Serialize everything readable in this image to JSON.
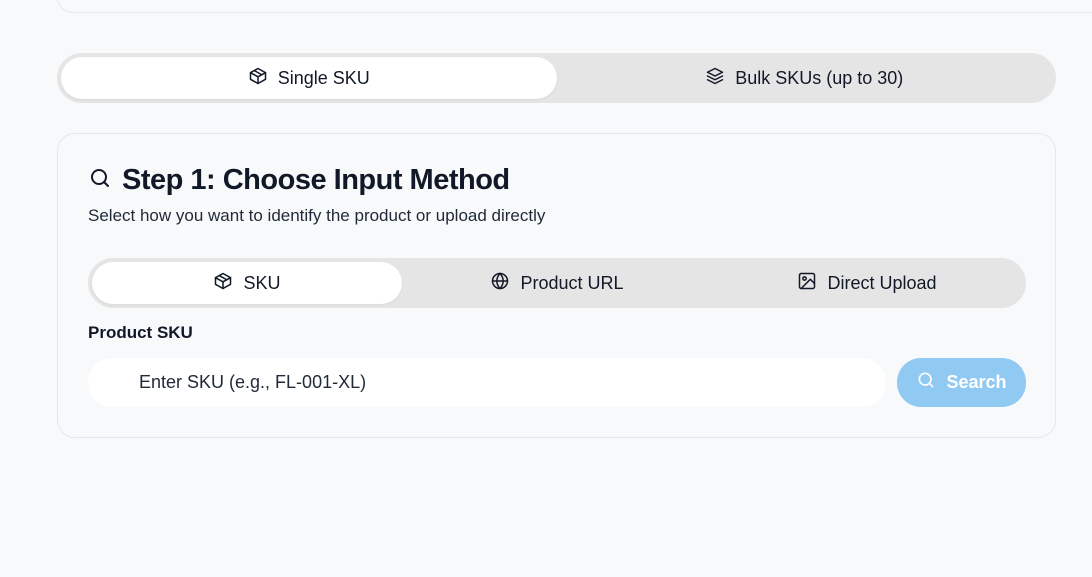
{
  "mode_toggle": {
    "tabs": [
      {
        "label": "Single SKU",
        "icon": "box-icon",
        "active": true
      },
      {
        "label": "Bulk SKUs (up to 30)",
        "icon": "layers-icon",
        "active": false
      }
    ]
  },
  "step": {
    "title": "Step 1: Choose Input Method",
    "subtitle": "Select how you want to identify the product or upload directly",
    "icon": "search-icon"
  },
  "method_toggle": {
    "tabs": [
      {
        "label": "SKU",
        "icon": "box-icon",
        "active": true
      },
      {
        "label": "Product URL",
        "icon": "globe-icon",
        "active": false
      },
      {
        "label": "Direct Upload",
        "icon": "image-icon",
        "active": false
      }
    ]
  },
  "sku_field": {
    "label": "Product SKU",
    "value": "",
    "placeholder": "Enter SKU (e.g., FL-001-XL)"
  },
  "search_button": {
    "label": "Search",
    "icon": "search-icon",
    "color": "#90caf3"
  },
  "colors": {
    "background": "#f8f9fa",
    "toggle_track": "#e5e5e5",
    "active_tab": "#ffffff"
  }
}
